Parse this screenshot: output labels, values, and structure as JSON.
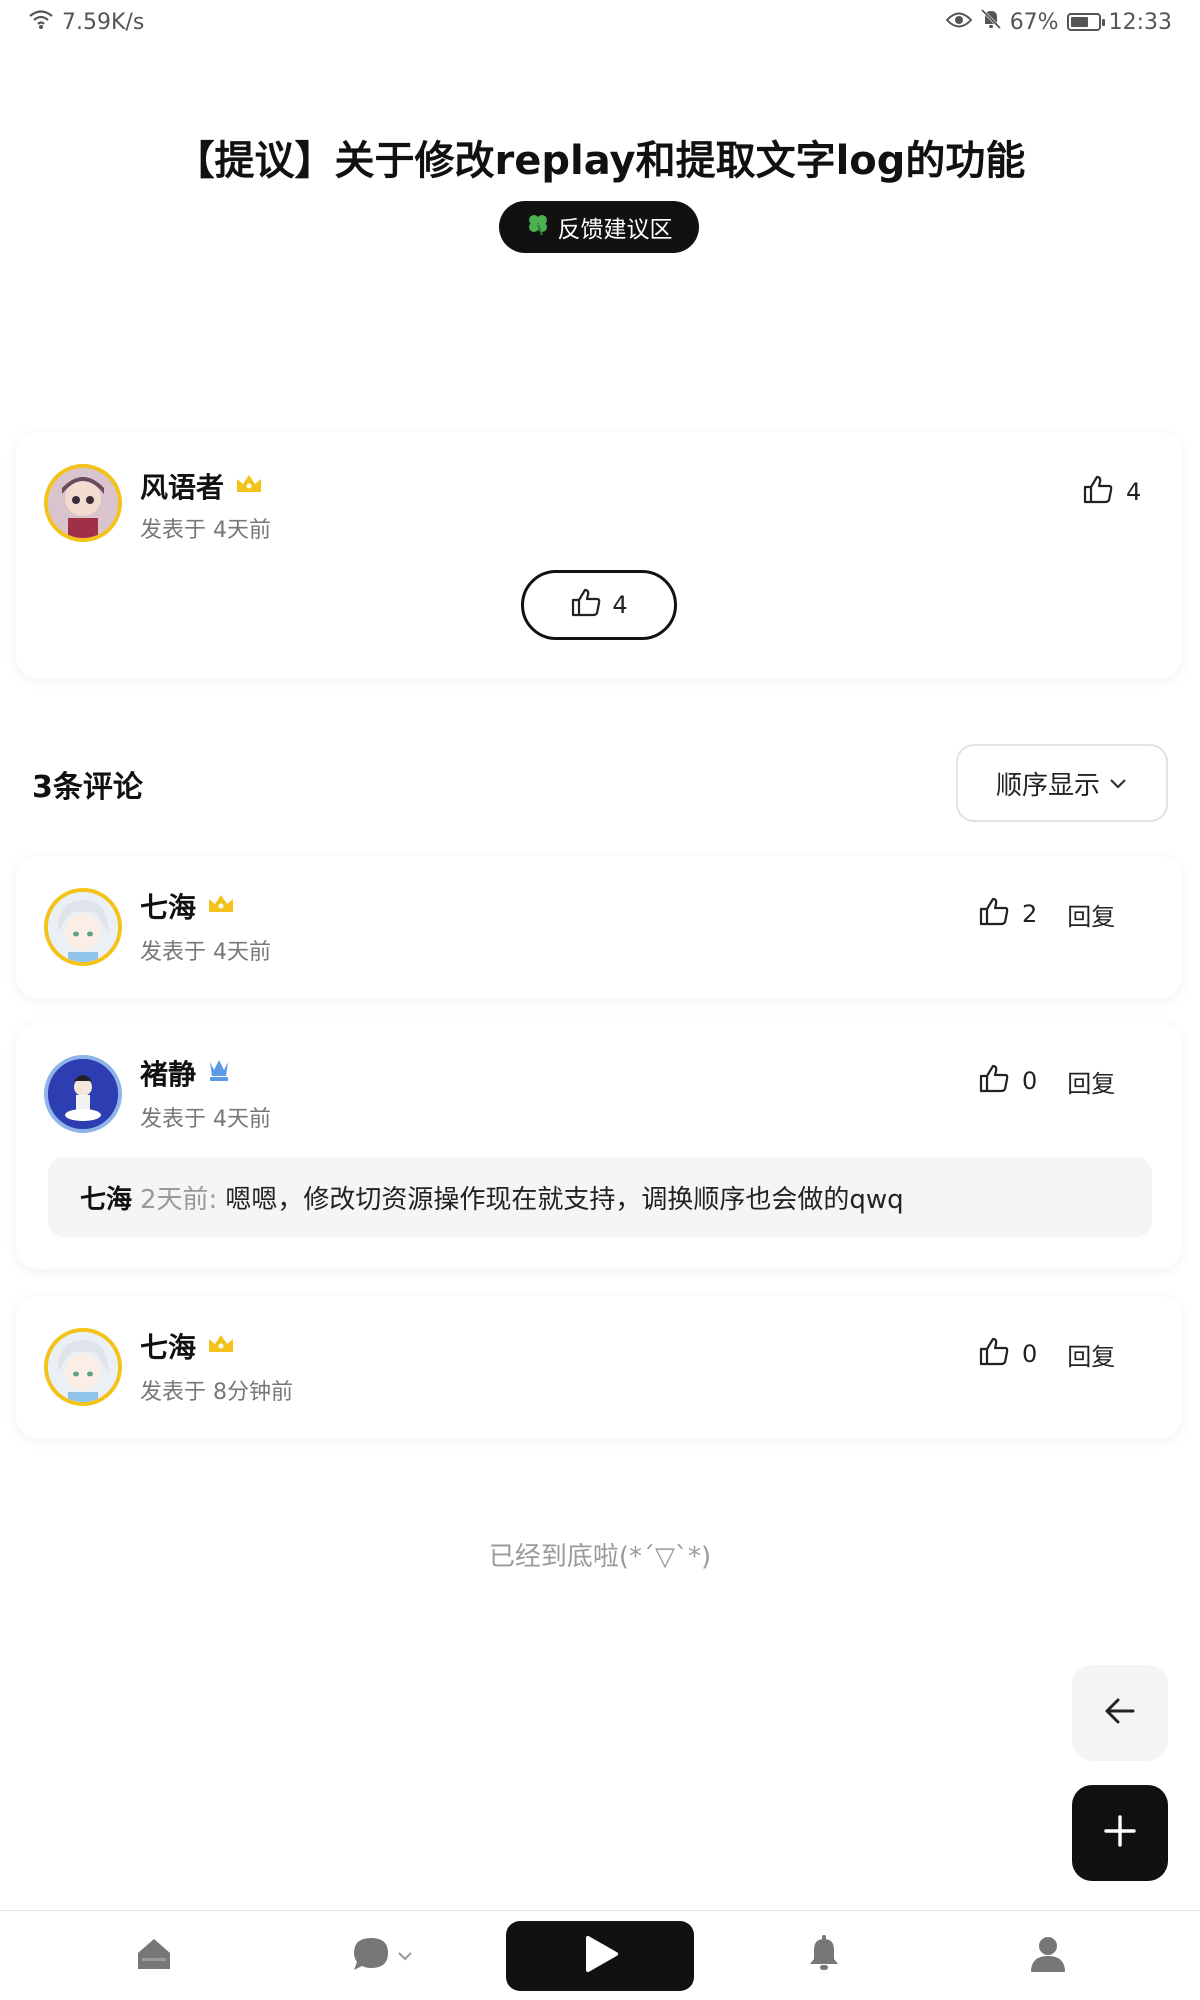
{
  "status_bar": {
    "network_speed": "7.59K/s",
    "battery_percent": "67%",
    "battery_level": 0.67,
    "time": "12:33",
    "icons": [
      "wifi-icon",
      "eye-icon",
      "bell-off-icon",
      "battery-icon"
    ]
  },
  "post": {
    "title": "【提议】关于修改replay和提取文字log的功能",
    "category_tag": "反馈建议区",
    "category_icon": "clover-icon",
    "author": {
      "name": "风语者",
      "badge": "crown-icon",
      "posted": "发表于 4天前"
    },
    "like_count": "4",
    "like_button_count": "4"
  },
  "comments_section": {
    "heading": "3条评论",
    "sort_label": "顺序显示"
  },
  "comments": [
    {
      "name": "七海",
      "badge": "crown-icon",
      "posted": "发表于 4天前",
      "likes": "2",
      "reply_label": "回复"
    },
    {
      "name": "褚静",
      "badge": "chess-queen-icon",
      "posted": "发表于 4天前",
      "likes": "0",
      "reply_label": "回复",
      "nested_reply": {
        "name": "七海",
        "time": "2天前:",
        "text": "嗯嗯，修改切资源操作现在就支持，调换顺序也会做的qwq"
      }
    },
    {
      "name": "七海",
      "badge": "crown-icon",
      "posted": "发表于 8分钟前",
      "likes": "0",
      "reply_label": "回复"
    }
  ],
  "end_of_list": "已经到底啦(*ˊ▽ˋ*)",
  "colors": {
    "accent_dark": "#111111",
    "crown_gold": "#f3c21b",
    "queen_blue": "#5b9be6",
    "muted_text": "#777777"
  },
  "bottom_nav": [
    "home-icon",
    "chat-icon",
    "play-icon",
    "bell-icon",
    "user-icon"
  ]
}
